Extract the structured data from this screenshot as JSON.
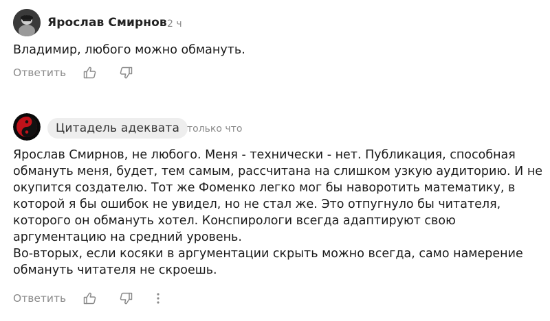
{
  "comments": [
    {
      "author": "Ярослав Смирнов",
      "time": "2 ч",
      "lines": [
        "Владимир, любого можно обмануть."
      ],
      "actions": {
        "reply_label": "Ответить"
      }
    },
    {
      "author": "Цитадель адеквата",
      "time": "только что",
      "lines": [
        "Ярослав Смирнов, не любого. Меня - технически - нет. Публикация, способная",
        "обмануть меня, будет, тем самым, рассчитана на слишком узкую аудиторию. И не",
        "окупится создателю. Тот же Фоменко легко мог бы наворотить математику, в",
        "которой я бы ошибок не увидел, но не стал же. Это отпугнуло бы читателя,",
        "которого он обмануть хотел. Конспирологи всегда адаптируют свою",
        "аргументацию на средний уровень.",
        "Во-вторых, если косяки в аргументации скрыть можно всегда, само намерение",
        "обмануть читателя не скроешь."
      ],
      "actions": {
        "reply_label": "Ответить"
      }
    }
  ],
  "icons": {
    "like": "thumbs-up-icon",
    "dislike": "thumbs-down-icon",
    "more": "more-vertical-icon"
  }
}
